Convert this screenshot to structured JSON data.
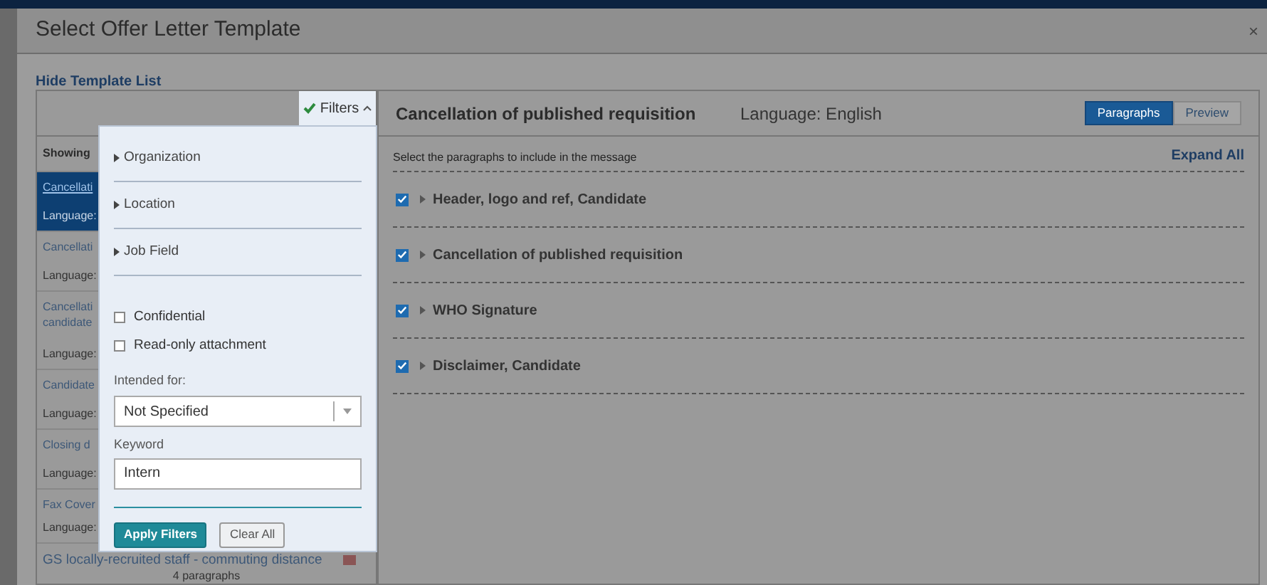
{
  "dialog": {
    "title": "Select Offer Letter Template",
    "close": "×"
  },
  "hide_link": "Hide Template List",
  "filters_toggle": {
    "label": "Filters",
    "expanded": true
  },
  "template_list": {
    "heading": "Showing",
    "items": [
      {
        "title": [
          "Cancellati"
        ],
        "language": "Language:",
        "selected": true
      },
      {
        "title": [
          "Cancellati"
        ],
        "language": "Language:",
        "selected": false
      },
      {
        "title": [
          "Cancellati",
          "candidate"
        ],
        "language": "Language:",
        "selected": false
      },
      {
        "title": [
          "Candidate"
        ],
        "language": "Language:",
        "selected": false
      },
      {
        "title": [
          "Closing d"
        ],
        "language": "Language:",
        "selected": false
      },
      {
        "title": [
          "Fax Cover"
        ],
        "language": "Language:",
        "selected": false
      },
      {
        "title": [
          "GS locally-recruited staff - commuting distance"
        ],
        "paragraphs": "4 paragraphs",
        "selected": false
      }
    ]
  },
  "filter_panel": {
    "sections": [
      {
        "label": "Organization",
        "expanded": false
      },
      {
        "label": "Location",
        "expanded": false
      },
      {
        "label": "Job Field",
        "expanded": false
      }
    ],
    "checkboxes": [
      {
        "label": "Confidential",
        "checked": false
      },
      {
        "label": "Read-only attachment",
        "checked": false
      }
    ],
    "intended_for": {
      "label": "Intended for:",
      "value": "Not Specified"
    },
    "keyword": {
      "label": "Keyword",
      "value": "Intern"
    },
    "buttons": [
      {
        "label": "Apply Filters",
        "kind": "primary"
      },
      {
        "label": "Clear All",
        "kind": "secondary"
      }
    ]
  },
  "template_view": {
    "title": "Cancellation of published requisition",
    "language": "Language: English",
    "view_toggle": [
      {
        "label": "Paragraphs",
        "selected": true
      },
      {
        "label": "Preview",
        "selected": false
      }
    ],
    "instruction": "Select the paragraphs to include in the message",
    "expand_all": "Expand All",
    "paragraphs": [
      {
        "label": "Header, logo and ref, Candidate",
        "checked": true,
        "expanded": false
      },
      {
        "label": "Cancellation of published requisition",
        "checked": true,
        "expanded": false
      },
      {
        "label": "WHO Signature",
        "checked": true,
        "expanded": false
      },
      {
        "label": "Disclaimer, Candidate",
        "checked": true,
        "expanded": false
      }
    ]
  }
}
